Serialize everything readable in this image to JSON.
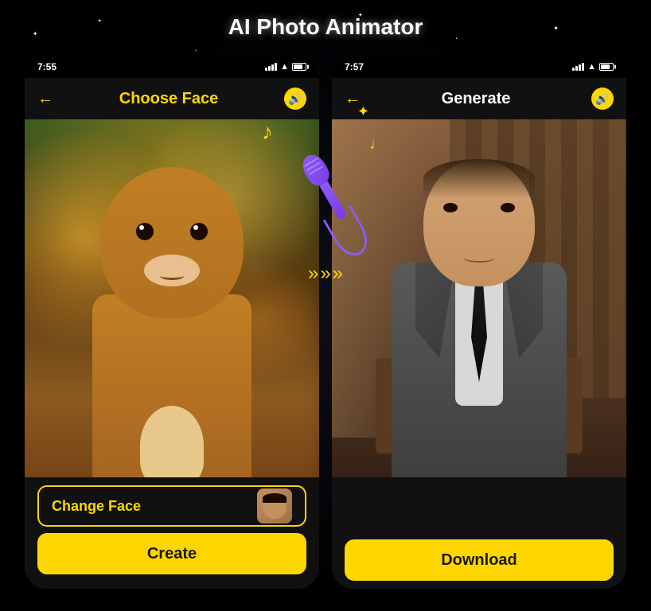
{
  "app": {
    "title": "AI Photo Animator"
  },
  "left_phone": {
    "status": {
      "time": "7:55"
    },
    "header": {
      "title": "Choose Face",
      "back_label": "←",
      "sound_label": "🔊"
    },
    "buttons": {
      "change_face_label": "Change Face",
      "create_label": "Create"
    }
  },
  "right_phone": {
    "status": {
      "time": "7:57"
    },
    "header": {
      "title": "Generate",
      "back_label": "←",
      "sound_label": "🔊"
    },
    "buttons": {
      "download_label": "Download"
    }
  },
  "decorations": {
    "music_note_1": "♪",
    "music_note_2": "♩",
    "sparkle": "✦",
    "arrows": [
      "»",
      "»",
      "»"
    ]
  }
}
